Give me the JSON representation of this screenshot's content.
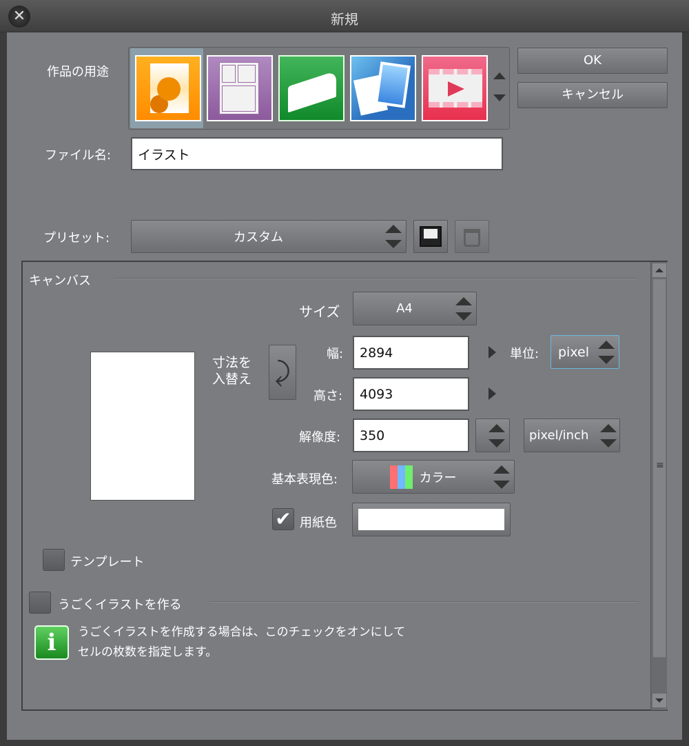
{
  "window": {
    "title": "新規"
  },
  "purpose": {
    "label": "作品の用途",
    "items": [
      {
        "name": "illustration",
        "color": "#ff9900"
      },
      {
        "name": "comic",
        "color": "#9c6aa6"
      },
      {
        "name": "book",
        "color": "#1f9a35"
      },
      {
        "name": "print-bundle",
        "color": "#2f7bc7"
      },
      {
        "name": "animation",
        "color": "#e8365a"
      }
    ]
  },
  "buttons": {
    "ok": "OK",
    "cancel": "キャンセル"
  },
  "file_name": {
    "label": "ファイル名:",
    "value": "イラスト"
  },
  "preset": {
    "label": "プリセット:",
    "value": "カスタム"
  },
  "canvas": {
    "section_label": "キャンバス",
    "swap_label_1": "寸法を",
    "swap_label_2": "入替え",
    "size": {
      "label": "サイズ",
      "value": "A4"
    },
    "width": {
      "label": "幅:",
      "value": "2894"
    },
    "height": {
      "label": "高さ:",
      "value": "4093"
    },
    "unit": {
      "label": "単位:",
      "value": "pixel"
    },
    "resolution": {
      "label": "解像度:",
      "value": "350",
      "unit": "pixel/inch"
    },
    "color_mode": {
      "label": "基本表現色:",
      "value": "カラー"
    },
    "paper_color": {
      "label": "用紙色",
      "checked": true,
      "color": "#ffffff"
    }
  },
  "template": {
    "label": "テンプレート",
    "checked": false
  },
  "animation": {
    "label": "うごくイラストを作る",
    "checked": false,
    "info_line1": "うごくイラストを作成する場合は、このチェックをオンにして",
    "info_line2": "セルの枚数を指定します。"
  }
}
